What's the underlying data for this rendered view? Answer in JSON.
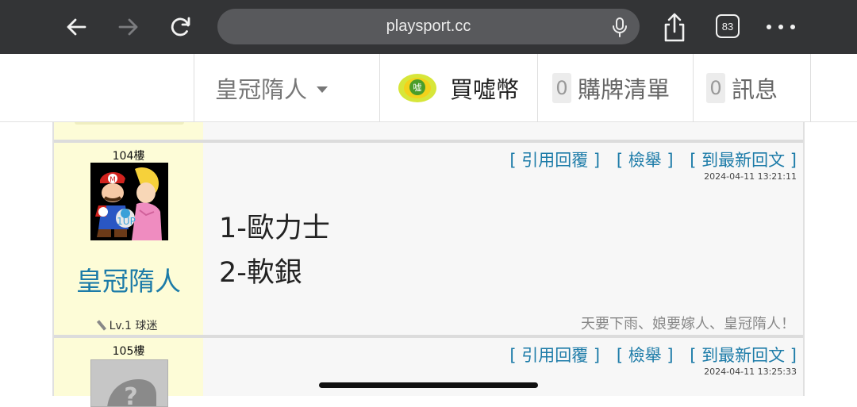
{
  "browser": {
    "url": "playsport.cc",
    "tab_count": "83"
  },
  "header": {
    "username": "皇冠隋人",
    "coin_label": "買噓幣",
    "coin_icon_text": "噓",
    "cart_count": "0",
    "cart_label": "購牌清單",
    "message_count": "0",
    "message_label": "訊息"
  },
  "posts": [
    {
      "floor": "104樓",
      "username": "皇冠隋人",
      "level": "Lv.1 球迷",
      "avatar_badge": "1UP",
      "actions": {
        "quote": "引用回覆",
        "report": "檢舉",
        "latest": "到最新回文"
      },
      "timestamp": "2024-04-11 13:21:11",
      "content_line1": "1-歐力士",
      "content_line2": "2-軟銀",
      "signature": "天要下雨、娘要嫁人、皇冠隋人！"
    },
    {
      "floor": "105樓",
      "actions": {
        "quote": "引用回覆",
        "report": "檢舉",
        "latest": "到最新回文"
      },
      "timestamp": "2024-04-11 13:25:33"
    }
  ]
}
